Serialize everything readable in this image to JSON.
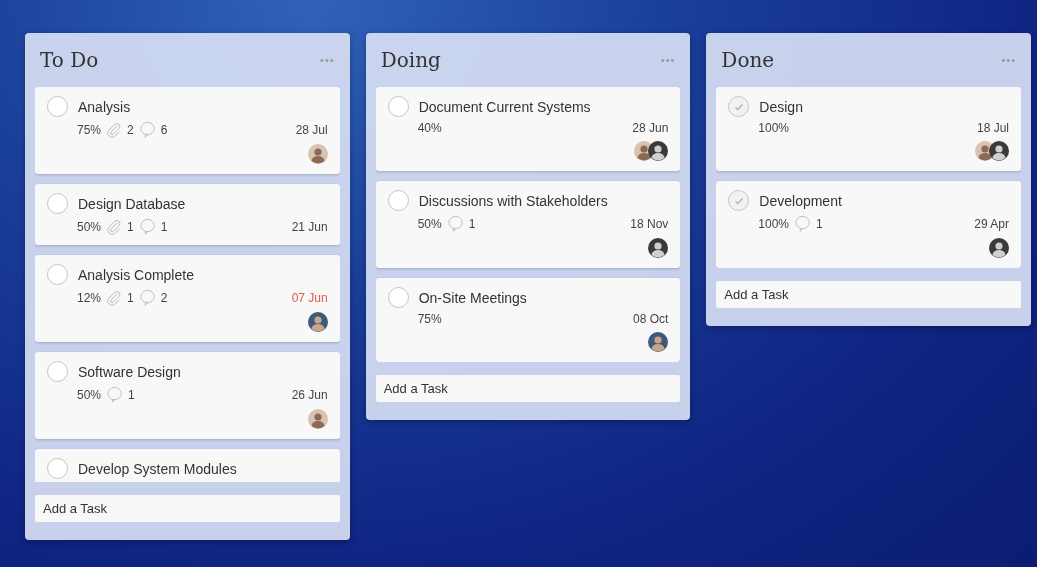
{
  "columns": [
    {
      "title": "To Do",
      "menu": "•••",
      "add_task": {
        "placeholder": "Add a Task"
      },
      "tasks": [
        {
          "title": "Analysis",
          "done": false,
          "percent": "75%",
          "attachments": "2",
          "comments": "6",
          "due": "28 Jul",
          "overdue": false,
          "assignees": [
            {
              "kind": "light"
            }
          ]
        },
        {
          "title": "Design Database",
          "done": false,
          "percent": "50%",
          "attachments": "1",
          "comments": "1",
          "due": "21 Jun",
          "overdue": false
        },
        {
          "title": "Analysis Complete",
          "done": false,
          "percent": "12%",
          "attachments": "1",
          "comments": "2",
          "due": "07 Jun",
          "overdue": true,
          "assignees": [
            {
              "kind": "color"
            }
          ]
        },
        {
          "title": "Software Design",
          "done": false,
          "percent": "50%",
          "comments": "1",
          "due": "26 Jun",
          "overdue": false,
          "assignees": [
            {
              "kind": "light"
            }
          ]
        },
        {
          "title": "Develop System Modules",
          "done": false
        }
      ]
    },
    {
      "title": "Doing",
      "menu": "•••",
      "add_task": {
        "placeholder": "Add a Task"
      },
      "tasks": [
        {
          "title": "Document Current Systems",
          "done": false,
          "percent": "40%",
          "due": "28 Jun",
          "overdue": false,
          "assignees": [
            {
              "kind": "light"
            },
            {
              "kind": "dark"
            }
          ]
        },
        {
          "title": "Discussions with Stakeholders",
          "done": false,
          "percent": "50%",
          "comments": "1",
          "due": "18 Nov",
          "overdue": false,
          "assignees": [
            {
              "kind": "dark"
            }
          ]
        },
        {
          "title": "On-Site Meetings",
          "done": false,
          "percent": "75%",
          "due": "08 Oct",
          "overdue": false,
          "assignees": [
            {
              "kind": "color"
            }
          ]
        }
      ]
    },
    {
      "title": "Done",
      "menu": "•••",
      "add_task": {
        "placeholder": "Add a Task"
      },
      "tasks": [
        {
          "title": "Design",
          "done": true,
          "percent": "100%",
          "due": "18 Jul",
          "overdue": false,
          "assignees": [
            {
              "kind": "light"
            },
            {
              "kind": "dark"
            }
          ]
        },
        {
          "title": "Development",
          "done": true,
          "percent": "100%",
          "comments": "1",
          "due": "29 Apr",
          "overdue": false,
          "assignees": [
            {
              "kind": "dark"
            }
          ]
        }
      ]
    }
  ]
}
